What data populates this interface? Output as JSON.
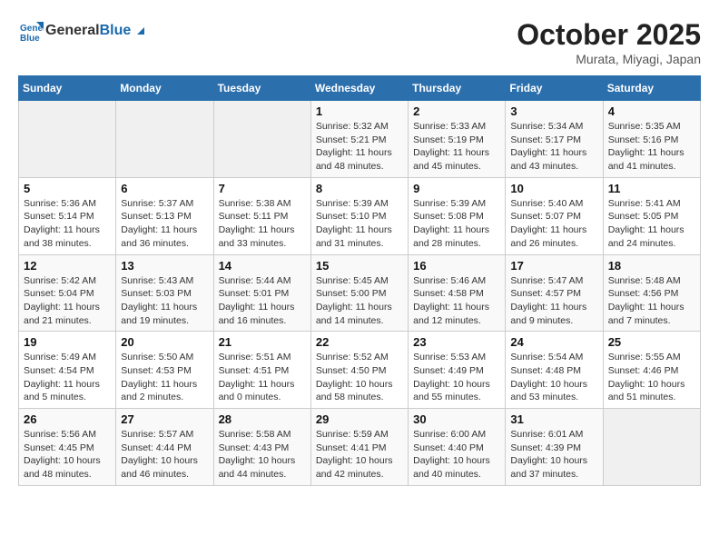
{
  "header": {
    "logo_line1": "General",
    "logo_line2": "Blue",
    "month": "October 2025",
    "location": "Murata, Miyagi, Japan"
  },
  "days_of_week": [
    "Sunday",
    "Monday",
    "Tuesday",
    "Wednesday",
    "Thursday",
    "Friday",
    "Saturday"
  ],
  "weeks": [
    [
      {
        "num": "",
        "info": ""
      },
      {
        "num": "",
        "info": ""
      },
      {
        "num": "",
        "info": ""
      },
      {
        "num": "1",
        "info": "Sunrise: 5:32 AM\nSunset: 5:21 PM\nDaylight: 11 hours and 48 minutes."
      },
      {
        "num": "2",
        "info": "Sunrise: 5:33 AM\nSunset: 5:19 PM\nDaylight: 11 hours and 45 minutes."
      },
      {
        "num": "3",
        "info": "Sunrise: 5:34 AM\nSunset: 5:17 PM\nDaylight: 11 hours and 43 minutes."
      },
      {
        "num": "4",
        "info": "Sunrise: 5:35 AM\nSunset: 5:16 PM\nDaylight: 11 hours and 41 minutes."
      }
    ],
    [
      {
        "num": "5",
        "info": "Sunrise: 5:36 AM\nSunset: 5:14 PM\nDaylight: 11 hours and 38 minutes."
      },
      {
        "num": "6",
        "info": "Sunrise: 5:37 AM\nSunset: 5:13 PM\nDaylight: 11 hours and 36 minutes."
      },
      {
        "num": "7",
        "info": "Sunrise: 5:38 AM\nSunset: 5:11 PM\nDaylight: 11 hours and 33 minutes."
      },
      {
        "num": "8",
        "info": "Sunrise: 5:39 AM\nSunset: 5:10 PM\nDaylight: 11 hours and 31 minutes."
      },
      {
        "num": "9",
        "info": "Sunrise: 5:39 AM\nSunset: 5:08 PM\nDaylight: 11 hours and 28 minutes."
      },
      {
        "num": "10",
        "info": "Sunrise: 5:40 AM\nSunset: 5:07 PM\nDaylight: 11 hours and 26 minutes."
      },
      {
        "num": "11",
        "info": "Sunrise: 5:41 AM\nSunset: 5:05 PM\nDaylight: 11 hours and 24 minutes."
      }
    ],
    [
      {
        "num": "12",
        "info": "Sunrise: 5:42 AM\nSunset: 5:04 PM\nDaylight: 11 hours and 21 minutes."
      },
      {
        "num": "13",
        "info": "Sunrise: 5:43 AM\nSunset: 5:03 PM\nDaylight: 11 hours and 19 minutes."
      },
      {
        "num": "14",
        "info": "Sunrise: 5:44 AM\nSunset: 5:01 PM\nDaylight: 11 hours and 16 minutes."
      },
      {
        "num": "15",
        "info": "Sunrise: 5:45 AM\nSunset: 5:00 PM\nDaylight: 11 hours and 14 minutes."
      },
      {
        "num": "16",
        "info": "Sunrise: 5:46 AM\nSunset: 4:58 PM\nDaylight: 11 hours and 12 minutes."
      },
      {
        "num": "17",
        "info": "Sunrise: 5:47 AM\nSunset: 4:57 PM\nDaylight: 11 hours and 9 minutes."
      },
      {
        "num": "18",
        "info": "Sunrise: 5:48 AM\nSunset: 4:56 PM\nDaylight: 11 hours and 7 minutes."
      }
    ],
    [
      {
        "num": "19",
        "info": "Sunrise: 5:49 AM\nSunset: 4:54 PM\nDaylight: 11 hours and 5 minutes."
      },
      {
        "num": "20",
        "info": "Sunrise: 5:50 AM\nSunset: 4:53 PM\nDaylight: 11 hours and 2 minutes."
      },
      {
        "num": "21",
        "info": "Sunrise: 5:51 AM\nSunset: 4:51 PM\nDaylight: 11 hours and 0 minutes."
      },
      {
        "num": "22",
        "info": "Sunrise: 5:52 AM\nSunset: 4:50 PM\nDaylight: 10 hours and 58 minutes."
      },
      {
        "num": "23",
        "info": "Sunrise: 5:53 AM\nSunset: 4:49 PM\nDaylight: 10 hours and 55 minutes."
      },
      {
        "num": "24",
        "info": "Sunrise: 5:54 AM\nSunset: 4:48 PM\nDaylight: 10 hours and 53 minutes."
      },
      {
        "num": "25",
        "info": "Sunrise: 5:55 AM\nSunset: 4:46 PM\nDaylight: 10 hours and 51 minutes."
      }
    ],
    [
      {
        "num": "26",
        "info": "Sunrise: 5:56 AM\nSunset: 4:45 PM\nDaylight: 10 hours and 48 minutes."
      },
      {
        "num": "27",
        "info": "Sunrise: 5:57 AM\nSunset: 4:44 PM\nDaylight: 10 hours and 46 minutes."
      },
      {
        "num": "28",
        "info": "Sunrise: 5:58 AM\nSunset: 4:43 PM\nDaylight: 10 hours and 44 minutes."
      },
      {
        "num": "29",
        "info": "Sunrise: 5:59 AM\nSunset: 4:41 PM\nDaylight: 10 hours and 42 minutes."
      },
      {
        "num": "30",
        "info": "Sunrise: 6:00 AM\nSunset: 4:40 PM\nDaylight: 10 hours and 40 minutes."
      },
      {
        "num": "31",
        "info": "Sunrise: 6:01 AM\nSunset: 4:39 PM\nDaylight: 10 hours and 37 minutes."
      },
      {
        "num": "",
        "info": ""
      }
    ]
  ]
}
